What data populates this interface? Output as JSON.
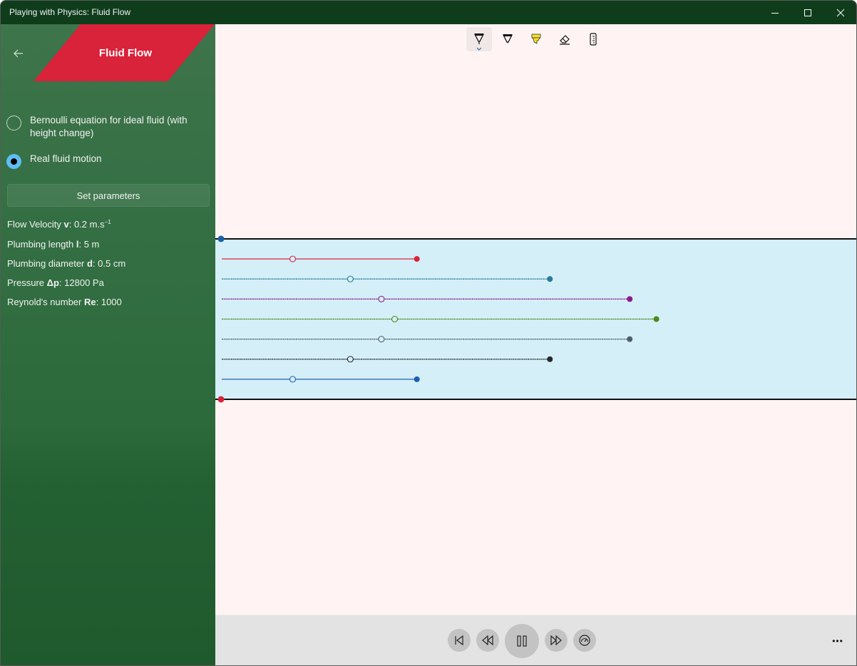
{
  "window": {
    "title": "Playing with Physics: Fluid Flow",
    "controls": [
      "minimize",
      "maximize",
      "close"
    ]
  },
  "sidebar": {
    "back_icon": "arrow-left-icon",
    "header_title": "Fluid Flow",
    "header_color": "#d8233a",
    "modes": [
      {
        "label": "Bernoulli equation for ideal fluid (with height change)",
        "checked": false
      },
      {
        "label": "Real fluid motion",
        "checked": true
      }
    ],
    "set_parameters_label": "Set parameters",
    "parameters": [
      {
        "prefix": "Flow Velocity ",
        "symbol": "v",
        "value": ": 0.2 m.s",
        "sup": "−1"
      },
      {
        "prefix": "Plumbing length ",
        "symbol": "l",
        "value": ": 5 m",
        "sup": ""
      },
      {
        "prefix": "Plumbing diameter ",
        "symbol": "d",
        "value": ": 0.5 cm",
        "sup": ""
      },
      {
        "prefix": "Pressure ",
        "symbol": "Δp",
        "value": ": 12800 Pa",
        "sup": ""
      },
      {
        "prefix": "Reynold's number ",
        "symbol": "Re",
        "value": ": 1000",
        "sup": ""
      }
    ]
  },
  "toolbar": {
    "tools": [
      {
        "name": "ballpoint-pen",
        "active": true
      },
      {
        "name": "pencil",
        "active": false
      },
      {
        "name": "highlighter",
        "active": false
      },
      {
        "name": "eraser",
        "active": false
      },
      {
        "name": "ruler",
        "active": false
      }
    ]
  },
  "simulation": {
    "pipe_top_marker_color": "#1a5fa8",
    "pipe_bottom_marker_color": "#d8233a",
    "pipe_fill": "#d4eff8",
    "streamlines": [
      {
        "color": "#d8233a",
        "progress": 0.44,
        "mid": 0.16
      },
      {
        "color": "#2a7a9a",
        "progress": 0.74,
        "mid": 0.29
      },
      {
        "color": "#8a1a8a",
        "progress": 0.92,
        "mid": 0.36
      },
      {
        "color": "#4a8a1a",
        "progress": 0.98,
        "mid": 0.39
      },
      {
        "color": "#4f5f6f",
        "progress": 0.92,
        "mid": 0.36
      },
      {
        "color": "#2a2a2a",
        "progress": 0.74,
        "mid": 0.29
      },
      {
        "color": "#1a60b0",
        "progress": 0.44,
        "mid": 0.16
      }
    ]
  },
  "playback": {
    "buttons": [
      "skip-to-start",
      "rewind",
      "pause",
      "fast-forward",
      "speed"
    ],
    "more_label": "•••"
  }
}
